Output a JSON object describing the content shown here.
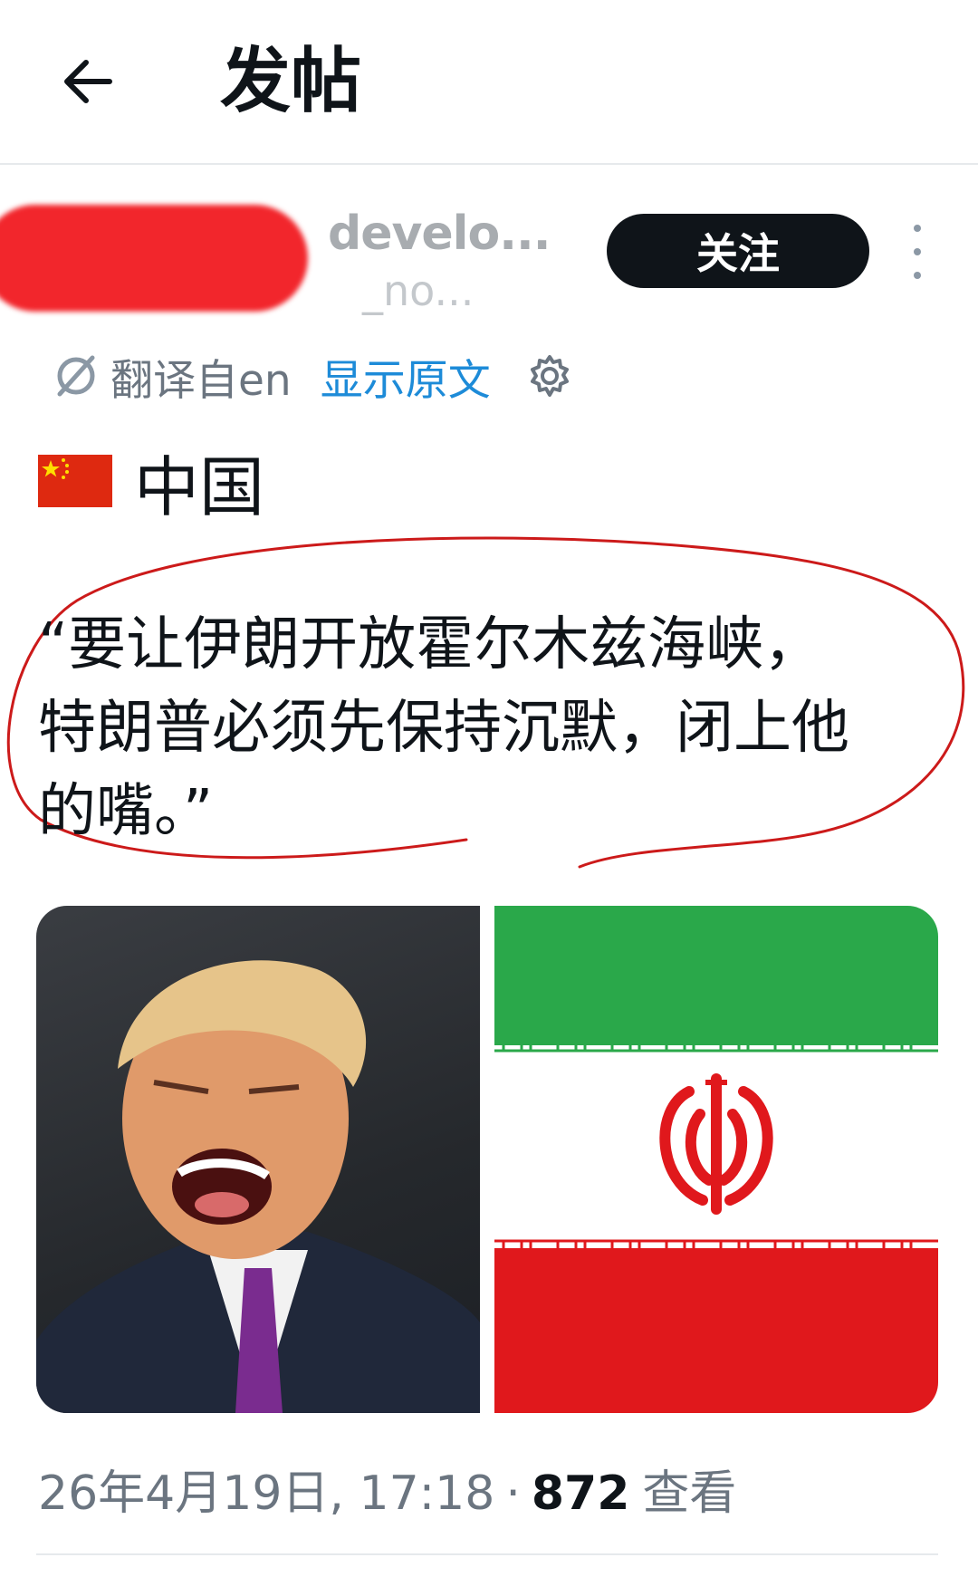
{
  "header": {
    "back_icon": "arrow-left-icon",
    "title": "发帖"
  },
  "author": {
    "display_name": "develo...",
    "handle": "_no...",
    "follow_label": "关注",
    "more_icon": "more-vertical-icon"
  },
  "translation": {
    "icon": "translate-icon",
    "label": "翻译自en",
    "show_original": "显示原文",
    "settings_icon": "gear-icon"
  },
  "post": {
    "country_flag": "china-flag",
    "country": "中国",
    "quote_line1": "“要让伊朗开放霍尔木兹海峡，",
    "quote_line2": "特朗普必须先保持沉默，闭上他",
    "quote_line3": "的嘴。”",
    "annotation_color": "#cc1a1a"
  },
  "media": [
    {
      "kind": "photo",
      "description_icon": "person-photo"
    },
    {
      "kind": "flag",
      "description_icon": "iran-flag",
      "colors": [
        "#2aa84a",
        "#ffffff",
        "#e0181c"
      ]
    }
  ],
  "meta": {
    "date": "26年4月19日, 17:18",
    "separator": "·",
    "views_count": "872",
    "views_label": "查看"
  }
}
